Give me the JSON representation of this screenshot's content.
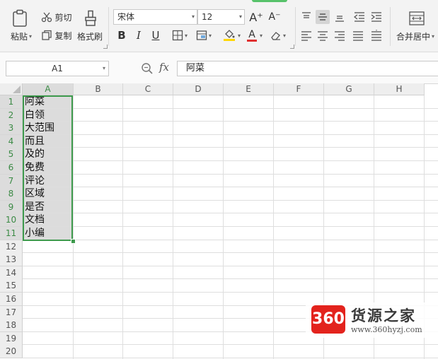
{
  "ribbon": {
    "paste_label": "粘贴",
    "cut_label": "剪切",
    "copy_label": "复制",
    "format_painter_label": "格式刷",
    "font_name": "宋体",
    "font_size": "12",
    "grow_font": "A⁺",
    "shrink_font": "A⁻",
    "bold": "B",
    "italic": "I",
    "underline": "U",
    "font_color_glyph": "A",
    "merge_label": "合并居中",
    "accent_color": "#57c26a",
    "fill_color": "#ffd700",
    "font_color": "#e03030"
  },
  "formula_bar": {
    "name_box": "A1",
    "fx_label": "fx",
    "value": "阿菜"
  },
  "sheet": {
    "columns": [
      "A",
      "B",
      "C",
      "D",
      "E",
      "F",
      "G",
      "H"
    ],
    "rows": [
      "1",
      "2",
      "3",
      "4",
      "5",
      "6",
      "7",
      "8",
      "9",
      "10",
      "11",
      "12",
      "13",
      "14",
      "15",
      "16",
      "17",
      "18",
      "19",
      "20"
    ],
    "column_a_values": [
      "阿菜",
      "白领",
      "大范围",
      "而且",
      "及的",
      "免费",
      "评论",
      "区域",
      "是否",
      "文档",
      "小编"
    ],
    "selection_color": "#3e9a4d"
  },
  "watermark": {
    "logo_text": "360",
    "name": "货源之家",
    "url": "www.360hyzj.com",
    "logo_color": "#e3231d"
  }
}
